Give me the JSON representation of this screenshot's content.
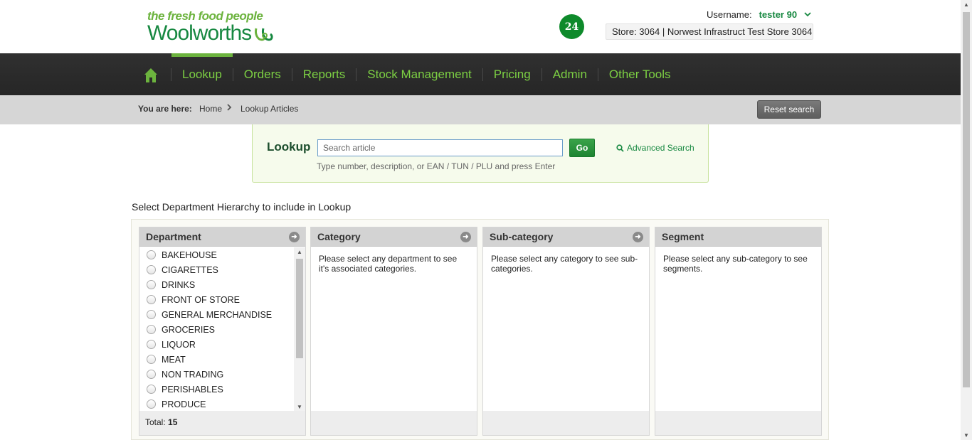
{
  "header": {
    "tagline": "the fresh food people",
    "brand": "Woolworths",
    "notification_count": "24",
    "username_label": "Username:",
    "username": "tester 90",
    "store": "Store: 3064 | Norwest Infrastruct Test Store 3064"
  },
  "nav": {
    "items": [
      {
        "label": "Lookup",
        "active": true
      },
      {
        "label": "Orders"
      },
      {
        "label": "Reports"
      },
      {
        "label": "Stock Management"
      },
      {
        "label": "Pricing"
      },
      {
        "label": "Admin"
      },
      {
        "label": "Other Tools"
      }
    ]
  },
  "breadcrumb": {
    "prefix": "You are here:",
    "items": [
      "Home",
      "Lookup Articles"
    ],
    "reset_label": "Reset search"
  },
  "lookup": {
    "label": "Lookup",
    "placeholder": "Search article",
    "go_label": "Go",
    "advanced_label": "Advanced Search",
    "hint": "Type number, description, or EAN / TUN / PLU and press Enter"
  },
  "hierarchy": {
    "title": "Select Department Hierarchy to include in Lookup",
    "columns": {
      "department": {
        "title": "Department",
        "items": [
          "BAKEHOUSE",
          "CIGARETTES",
          "DRINKS",
          "FRONT OF STORE",
          "GENERAL MERCHANDISE",
          "GROCERIES",
          "LIQUOR",
          "MEAT",
          "NON TRADING",
          "PERISHABLES",
          "PRODUCE"
        ],
        "total_label": "Total:",
        "total": "15"
      },
      "category": {
        "title": "Category",
        "message": "Please select any department to see it's associated categories."
      },
      "subcategory": {
        "title": "Sub-category",
        "message": "Please select any category to see sub-categories."
      },
      "segment": {
        "title": "Segment",
        "message": "Please select any sub-category to see segments."
      }
    }
  },
  "colors": {
    "brand_green": "#178841",
    "accent_green": "#6cb33e",
    "nav_bg": "#2b2b2b"
  }
}
